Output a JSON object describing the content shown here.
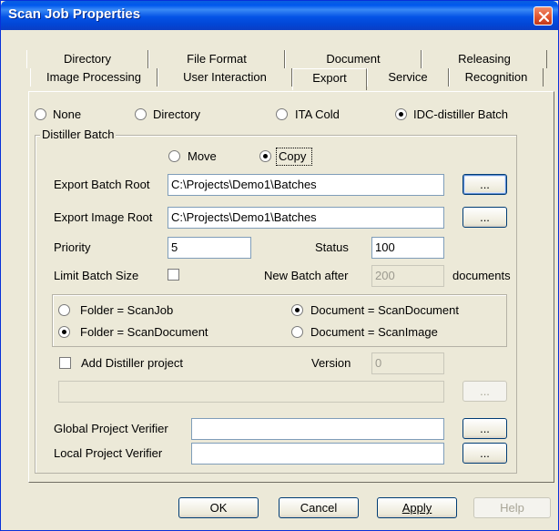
{
  "window": {
    "title": "Scan Job Properties"
  },
  "tabs": {
    "row1": [
      "Directory",
      "File Format",
      "Document",
      "Releasing"
    ],
    "row2": [
      "Image Processing",
      "User Interaction",
      "Export",
      "Service",
      "Recognition"
    ],
    "active": "Export"
  },
  "export_type": {
    "options": [
      "None",
      "Directory",
      "ITA Cold",
      "IDC-distiller Batch"
    ],
    "selected": "IDC-distiller Batch"
  },
  "distiller_batch": {
    "caption": "Distiller Batch",
    "move_label": "Move",
    "copy_label": "Copy",
    "selected": "Copy",
    "export_batch_root_label": "Export Batch Root",
    "export_batch_root_value": "C:\\Projects\\Demo1\\Batches",
    "export_image_root_label": "Export Image Root",
    "export_image_root_value": "C:\\Projects\\Demo1\\Batches",
    "browse_label": "...",
    "priority_label": "Priority",
    "priority_value": "5",
    "status_label": "Status",
    "status_value": "100",
    "limit_batch_size_label": "Limit Batch Size",
    "limit_batch_size_checked": false,
    "new_batch_after_label": "New Batch after",
    "new_batch_after_value": "200",
    "documents_label": "documents"
  },
  "mapping": {
    "folder_scanjob": "Folder = ScanJob",
    "folder_scandocument": "Folder = ScanDocument",
    "document_scandocument": "Document = ScanDocument",
    "document_scanimage": "Document = ScanImage",
    "folder_selected": "Folder = ScanDocument",
    "document_selected": "Document = ScanDocument"
  },
  "distiller_project": {
    "add_label": "Add Distiller project",
    "add_checked": false,
    "version_label": "Version",
    "version_value": "0",
    "path_value": ""
  },
  "verifiers": {
    "global_label": "Global Project Verifier",
    "global_value": "",
    "local_label": "Local Project Verifier",
    "local_value": ""
  },
  "buttons": {
    "ok": "OK",
    "cancel": "Cancel",
    "apply": "Apply",
    "help": "Help"
  }
}
